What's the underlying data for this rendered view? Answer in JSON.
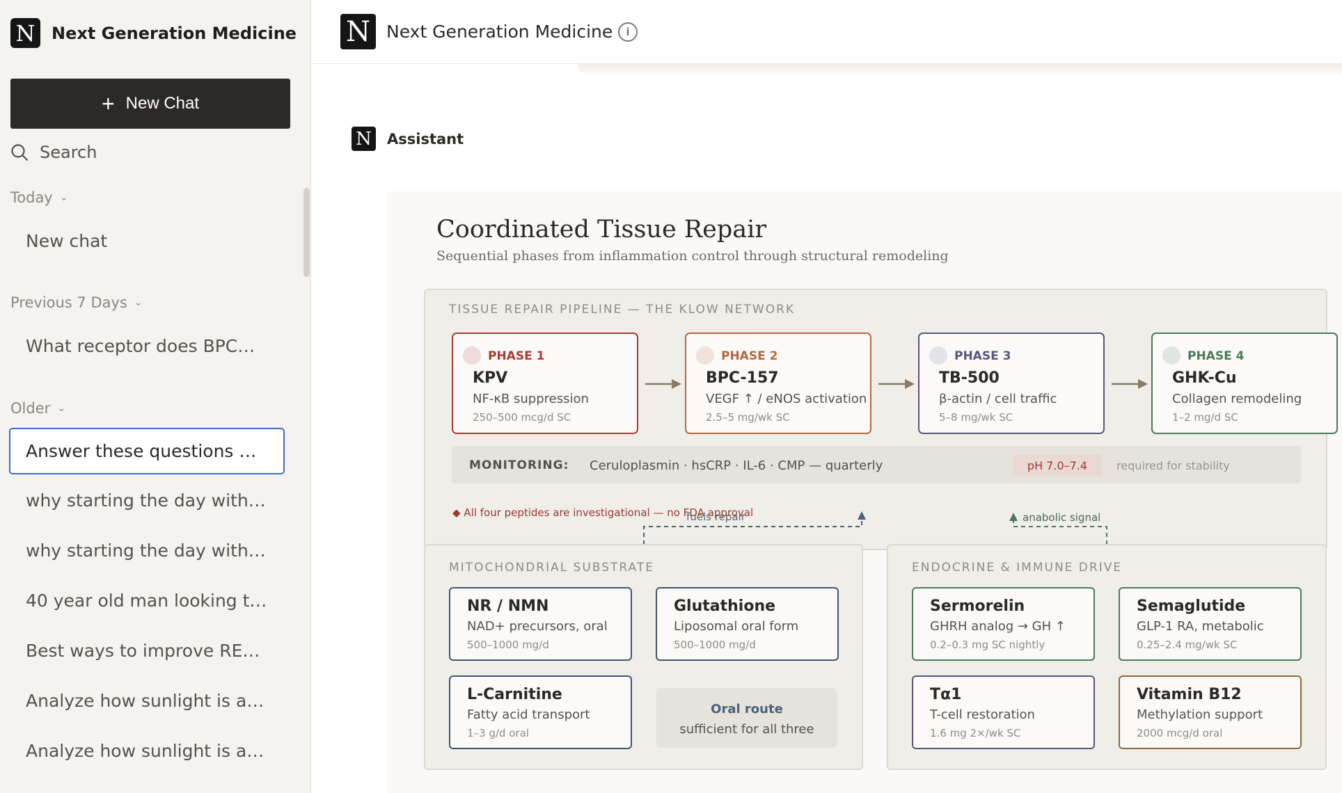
{
  "sidebar": {
    "brand": "Next Generation Medicine",
    "logo_letter": "N",
    "new_chat": "New Chat",
    "search": "Search",
    "sections": [
      {
        "label": "Today",
        "items": [
          "New chat"
        ]
      },
      {
        "label": "Previous 7 Days",
        "items": [
          "What receptor does BPC…"
        ]
      },
      {
        "label": "Older",
        "items": [
          "Answer these questions …",
          "why starting the day with…",
          "why starting the day with…",
          "40 year old man looking t…",
          "Best ways to improve RE…",
          "Analyze how sunlight is a…",
          "Analyze how sunlight is a…"
        ]
      }
    ]
  },
  "header": {
    "title": "Next Generation Medicine",
    "info_icon": "i"
  },
  "assistant_label": "Assistant",
  "diagram": {
    "title": "Coordinated Tissue Repair",
    "subtitle": "Sequential phases from inflammation control through structural remodeling",
    "pipeline_label": "TISSUE REPAIR PIPELINE — THE KLOW NETWORK",
    "phases": [
      {
        "tag": "PHASE 1",
        "name": "KPV",
        "desc": "NF-κB suppression",
        "dose": "250–500 mcg/d SC",
        "color": "#a83c34",
        "dot": "#eddcdb"
      },
      {
        "tag": "PHASE 2",
        "name": "BPC-157",
        "desc": "VEGF ↑ / eNOS activation",
        "dose": "2.5–5 mg/wk SC",
        "color": "#b5683e",
        "dot": "#f1e2da"
      },
      {
        "tag": "PHASE 3",
        "name": "TB-500",
        "desc": "β-actin / cell traffic",
        "dose": "5–8 mg/wk SC",
        "color": "#5a5579",
        "dot": "#e3e2e8"
      },
      {
        "tag": "PHASE 4",
        "name": "GHK-Cu",
        "desc": "Collagen remodeling",
        "dose": "1–2 mg/d SC",
        "color": "#4a7a58",
        "dot": "#dfe6e0"
      }
    ],
    "monitoring": {
      "label": "MONITORING:",
      "text": "Ceruloplasmin · hsCRP · IL-6 · CMP — quarterly",
      "ph": "pH 7.0–7.4",
      "note": "required for stability"
    },
    "warning": "◆ All four peptides are investigational — no FDA approval",
    "fuels_label": "fuels repair",
    "anabolic_label": "anabolic signal",
    "mito": {
      "label": "MITOCHONDRIAL SUBSTRATE",
      "cards": [
        {
          "name": "NR / NMN",
          "desc": "NAD+ precursors, oral",
          "dose": "500–1000 mg/d"
        },
        {
          "name": "Glutathione",
          "desc": "Liposomal oral form",
          "dose": "500–1000 mg/d"
        },
        {
          "name": "L-Carnitine",
          "desc": "Fatty acid transport",
          "dose": "1–3 g/d oral"
        }
      ],
      "oral_title": "Oral route",
      "oral_text": "sufficient for all three",
      "color": "#3f5670"
    },
    "endo": {
      "label": "ENDOCRINE & IMMUNE DRIVE",
      "cards": [
        {
          "name": "Sermorelin",
          "desc": "GHRH analog → GH ↑",
          "dose": "0.2–0.3 mg SC nightly",
          "color": "#4a7a58"
        },
        {
          "name": "Semaglutide",
          "desc": "GLP-1 RA, metabolic",
          "dose": "0.25–2.4 mg/wk SC",
          "color": "#4a7a58"
        },
        {
          "name": "Tα1",
          "desc": "T-cell restoration",
          "dose": "1.6 mg 2×/wk SC",
          "color": "#5a5579"
        },
        {
          "name": "Vitamin B12",
          "desc": "Methylation support",
          "dose": "2000 mcg/d oral",
          "color": "#8a6a3c"
        }
      ]
    }
  }
}
